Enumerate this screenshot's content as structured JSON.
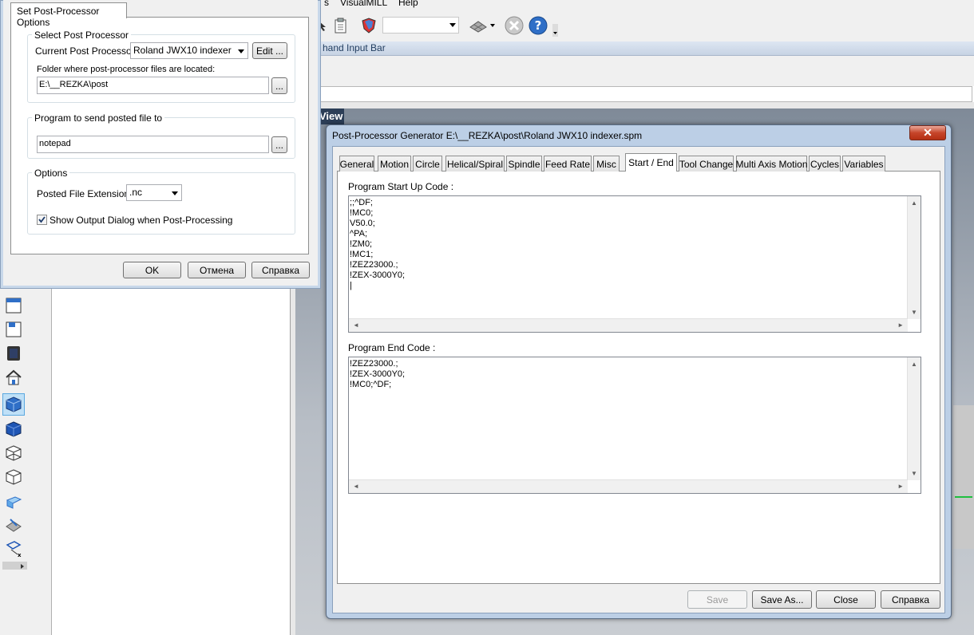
{
  "menubar": {
    "items": [
      "s",
      "VisualMILL",
      "Help"
    ]
  },
  "command_bar": {
    "title": "hand Input Bar"
  },
  "viewport": {
    "title": "View"
  },
  "set_pp_dialog": {
    "tab_label": "Set Post-Processor Options",
    "select_group": {
      "title": "Select Post Processor",
      "current_label": "Current Post Processor:",
      "current_value": "Roland JWX10 indexer",
      "edit_button": "Edit ...",
      "folder_label": "Folder where post-processor files are located:",
      "folder_value": "E:\\__REZKA\\post",
      "browse_button": "..."
    },
    "program_group": {
      "title": "Program to send posted file to",
      "value": "notepad",
      "browse_button": "..."
    },
    "options_group": {
      "title": "Options",
      "extension_label": "Posted File Extension:",
      "extension_value": ".nc",
      "show_output_label": "Show Output Dialog when Post-Processing",
      "show_output_checked": true
    },
    "buttons": {
      "ok": "OK",
      "cancel": "Отмена",
      "help": "Справка"
    }
  },
  "ppg_dialog": {
    "title": "Post-Processor Generator   E:\\__REZKA\\post\\Roland JWX10 indexer.spm",
    "tabs": [
      "General",
      "Motion",
      "Circle",
      "Helical/Spiral",
      "Spindle",
      "Feed Rate",
      "Misc",
      "Start / End",
      "Tool Change",
      "Multi Axis Motion",
      "Cycles",
      "Variables"
    ],
    "selected_tab": "Start / End",
    "start_label": "Program Start Up Code :",
    "start_code": ";;^DF;\n!MC0;\nV50.0;\n^PA;\n!ZM0;\n!MC1;\n!ZEZ23000.;\n!ZEX-3000Y0;\n|",
    "end_label": "Program End Code :",
    "end_code": "!ZEZ23000.;\n!ZEX-3000Y0;\n!MC0;^DF;",
    "buttons": {
      "save": "Save",
      "save_as": "Save As...",
      "close": "Close",
      "help": "Справка"
    }
  },
  "colors": {
    "window_bg": "#f0f0f0",
    "titlebar": "#bccfe6",
    "close_red": "#c6452a"
  }
}
